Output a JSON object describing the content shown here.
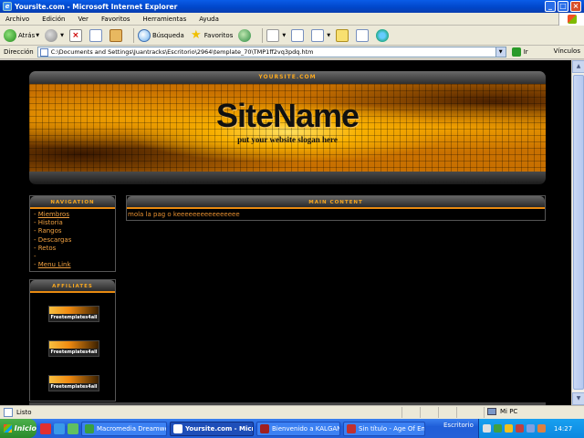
{
  "window": {
    "title": "Yoursite.com - Microsoft Internet Explorer"
  },
  "menu": [
    "Archivo",
    "Edición",
    "Ver",
    "Favoritos",
    "Herramientas",
    "Ayuda"
  ],
  "toolbar": {
    "back": "Atrás",
    "search": "Búsqueda",
    "favorites": "Favoritos"
  },
  "address": {
    "label": "Dirección",
    "value": "C:\\Documents and Settings\\Juantracks\\Escritorio\\2964\\template_70\\TMP1ff2vq3pdq.htm",
    "go": "Ir",
    "links": "Vínculos"
  },
  "site": {
    "header_label": "YOURSITE.COM",
    "name": "SiteName",
    "slogan": "put your website slogan here",
    "nav_title": "NAVIGATION",
    "nav_items": [
      "- Miembros",
      "- Historia",
      "- Rangos",
      "- Descargas",
      "- Retos",
      "-",
      "- Menu Link"
    ],
    "main_title": "MAIN CONTENT",
    "main_text": "mola la pag o keeeeeeeeeeeeeeee",
    "affiliates_title": "AFFILIATES",
    "affiliate_label": "Freetemplates4all"
  },
  "status": {
    "text": "Listo",
    "zone": "Mi PC"
  },
  "taskbar": {
    "start": "Inicio",
    "tasks": [
      "Macromedia Dreamwe...",
      "Yoursite.com - Micr...",
      "Bienvenido a KALGAN,...",
      "Sin título - Age Of Em..."
    ],
    "desktop": "Escritorio",
    "clock": "14:27"
  },
  "colors": {
    "accent": "#f8a820",
    "link": "#f0a040",
    "text": "#e89030"
  }
}
